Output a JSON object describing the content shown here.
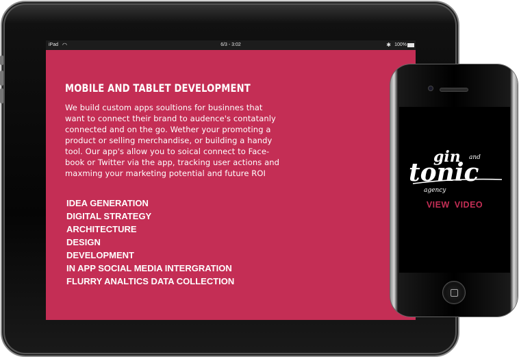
{
  "ipad": {
    "status": {
      "carrier": "iPad",
      "time": "6/3 - 3:02",
      "battery": "100%"
    },
    "title": "MOBILE AND TABLET DEVELOPMENT",
    "intro_lines": [
      "We build custom apps soultions for businnes that",
      "want to connect their brand to audence's contatanly",
      "connected and on the go. Wether your promoting a",
      "product or selling merchandise, or building a handy",
      "tool. Our app's allow you to soical connect to Face-",
      "book or Twitter via the app, tracking  user actions and",
      "maxming your marketing potential and  future ROI"
    ],
    "services": [
      "IDEA GENERATION",
      "DIGITAL STRATEGY",
      "ARCHITECTURE",
      "DESIGN",
      "DEVELOPMENT",
      "IN APP SOCIAL MEDIA INTERGRATION",
      "FLURRY ANALTICS DATA COLLECTION"
    ]
  },
  "iphone": {
    "logo": {
      "line1": "gin",
      "line2": "and",
      "line3": "tonic",
      "line4": "agency"
    },
    "view_video_label": "VIEW  VIDEO"
  },
  "colors": {
    "accent": "#c42e55",
    "text": "#ffffff",
    "device_frame": "#000000"
  }
}
